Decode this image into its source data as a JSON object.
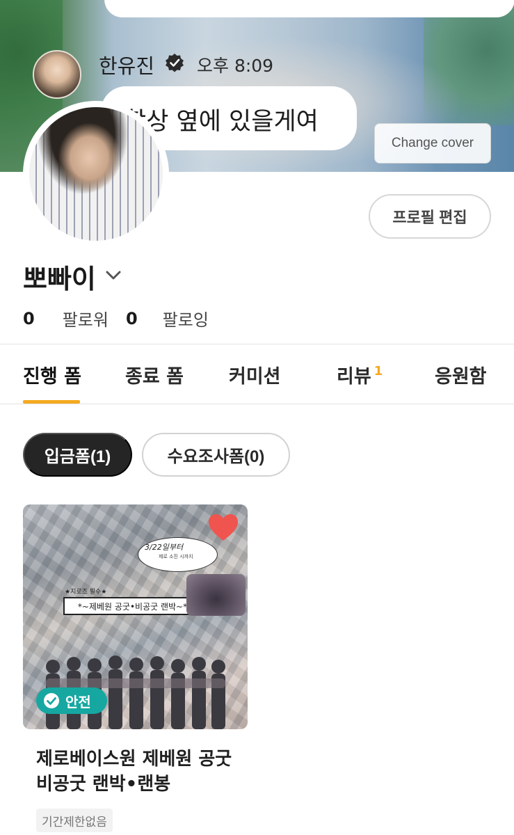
{
  "cover": {
    "chat_name": "한유진",
    "chat_time": "오후 8:09",
    "chat_message": "항상 옆에 있을게여",
    "change_cover_label": "Change cover"
  },
  "profile": {
    "edit_label": "프로필 편집",
    "username": "뽀빠이",
    "followers_count": "0",
    "followers_label": "팔로워",
    "following_count": "0",
    "following_label": "팔로잉"
  },
  "tabs": [
    {
      "label": "진행 폼",
      "active": true
    },
    {
      "label": "종료 폼",
      "active": false
    },
    {
      "label": "커미션",
      "active": false
    },
    {
      "label": "리뷰",
      "badge": "1",
      "active": false
    },
    {
      "label": "응원함",
      "active": false
    }
  ],
  "filters": {
    "deposit_label": "입금폼(1)",
    "survey_label": "수요조사폼(0)"
  },
  "card": {
    "image_cloud_text": "3/22일부터",
    "image_cloud_sub": "제로 소진 시까지",
    "image_banner_small": "★지로즈 필수★",
    "image_banner": "*~제베원 공굿•비공굿 랜박~*",
    "safe_label": "안전",
    "title": "제로베이스원 제베원 공굿비공굿 랜박•랜봉",
    "tag": "기간제한없음"
  },
  "colors": {
    "accent": "#f4a91f",
    "safe": "#16a7a1",
    "active_pill": "#252525",
    "heart": "#f0544f"
  }
}
